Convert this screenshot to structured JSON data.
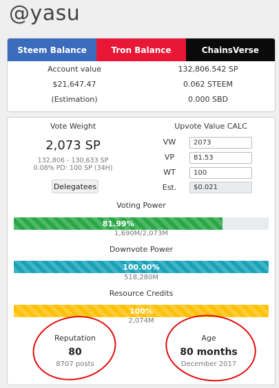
{
  "profile": {
    "username": "@yasu"
  },
  "tabs": [
    {
      "label": "Steem Balance"
    },
    {
      "label": "Tron Balance"
    },
    {
      "label": "ChainsVerse"
    }
  ],
  "balances": [
    {
      "label": "Account value",
      "value": "132,806.542 SP"
    },
    {
      "label": "$21,647.47",
      "value": "0.062 STEEM"
    },
    {
      "label": "(Estimation)",
      "value": "0.000 SBD"
    }
  ],
  "vote_weight": {
    "title": "Vote Weight",
    "value": "2,073 SP",
    "range": "132,806 - 130,633 SP",
    "pd": "0.08% PD: 100 SP (34H)",
    "delegatees_label": "Delegatees"
  },
  "calc": {
    "title": "Upvote Value CALC",
    "vw_label": "VW",
    "vw_value": "2073",
    "vp_label": "VP",
    "vp_value": "81.53",
    "wt_label": "WT",
    "wt_value": "100",
    "est_label": "Est.",
    "est_value": "$0.021"
  },
  "voting_power": {
    "title": "Voting Power",
    "percent_label": "81.99%",
    "fraction": 0.8199,
    "sub": "1,690M/2,073M"
  },
  "downvote_power": {
    "title": "Downvote Power",
    "percent_label": "100.00%",
    "fraction": 1.0,
    "sub": "518,280M"
  },
  "resource_credits": {
    "title": "Resource Credits",
    "percent_label": "100%",
    "fraction": 1.0,
    "sub": "2,074M"
  },
  "reputation": {
    "title": "Reputation",
    "value": "80",
    "sub": "8707 posts"
  },
  "age": {
    "title": "Age",
    "value": "80 months",
    "sub": "December 2017"
  },
  "colors": {
    "steem_tab": "#3b6bbd",
    "tron_tab": "#ea1636",
    "chains_tab": "#0a0a0a",
    "voting_bar": "#28a745",
    "downvote_bar": "#17a2b8",
    "rc_bar": "#ffc107",
    "annotation": "#e20a0a"
  }
}
